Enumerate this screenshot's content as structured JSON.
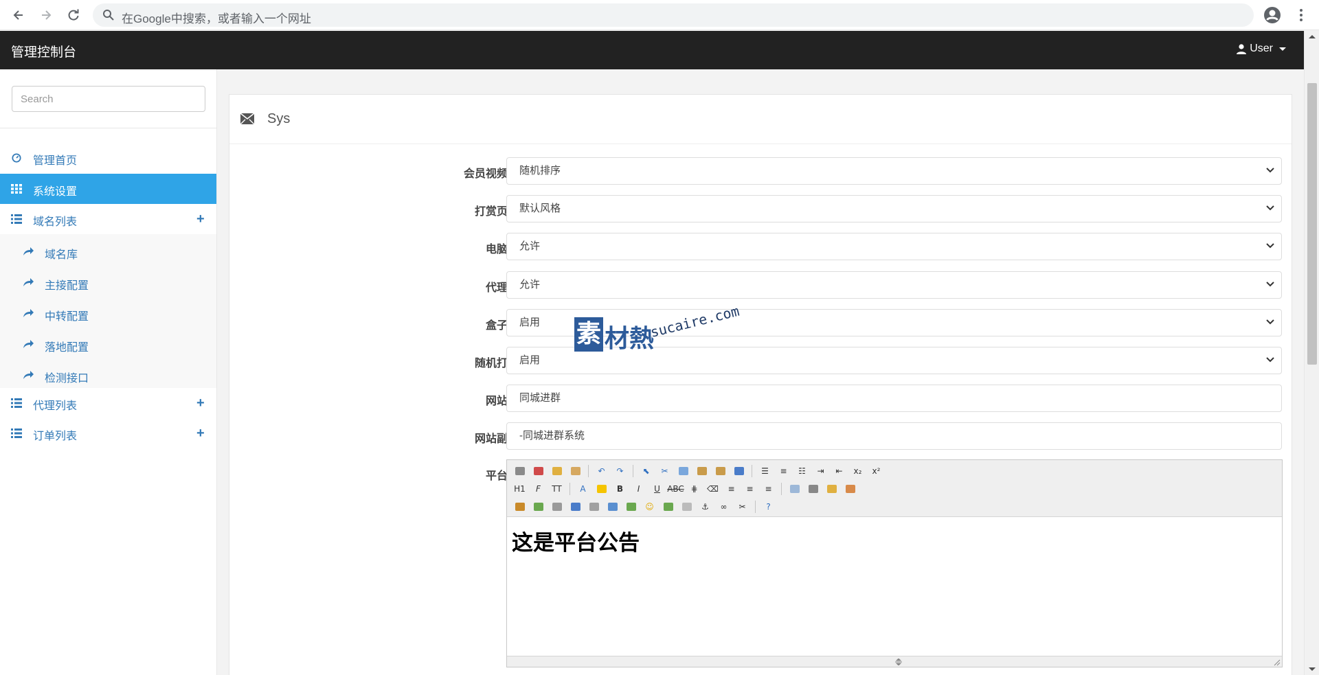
{
  "browser": {
    "address_placeholder": "在Google中搜索，或者输入一个网址"
  },
  "topbar": {
    "brand": "管理控制台",
    "user_label": "User"
  },
  "sidebar": {
    "search_placeholder": "Search",
    "items": [
      {
        "label": "管理首页",
        "icon": "dashboard-icon"
      },
      {
        "label": "系统设置",
        "icon": "grid-icon",
        "active": true
      },
      {
        "label": "域名列表",
        "icon": "list-icon",
        "expandable": true
      },
      {
        "label": "代理列表",
        "icon": "list-icon",
        "expandable": true
      },
      {
        "label": "订单列表",
        "icon": "list-icon",
        "expandable": true
      }
    ],
    "sub_items": [
      {
        "label": "域名库",
        "icon": "share-arrow-icon"
      },
      {
        "label": "主接配置",
        "icon": "share-arrow-icon"
      },
      {
        "label": "中转配置",
        "icon": "share-arrow-icon"
      },
      {
        "label": "落地配置",
        "icon": "share-arrow-icon"
      },
      {
        "label": "检测接口",
        "icon": "share-arrow-icon"
      }
    ],
    "accent_color": "#2fa4e7"
  },
  "panel": {
    "title": "Sys",
    "fields": [
      {
        "label": "会员视频排序",
        "type": "select",
        "value": "随机排序"
      },
      {
        "label": "打赏页模板",
        "type": "select",
        "value": "默认风格"
      },
      {
        "label": "电脑访问",
        "type": "select",
        "value": "允许"
      },
      {
        "label": "代理上传",
        "type": "select",
        "value": "允许"
      },
      {
        "label": "盒子推广",
        "type": "select",
        "value": "启用"
      },
      {
        "label": "随机打赏数",
        "type": "select",
        "value": "启用"
      },
      {
        "label": "网站标题",
        "type": "text",
        "value": "同城进群"
      },
      {
        "label": "网站副标题",
        "type": "text",
        "value": "-同城进群系统"
      }
    ],
    "editor": {
      "label": "平台公告",
      "content": "这是平台公告"
    }
  },
  "watermark": {
    "logo_char": "素",
    "name": "材熱",
    "url": "sucaire.com"
  }
}
